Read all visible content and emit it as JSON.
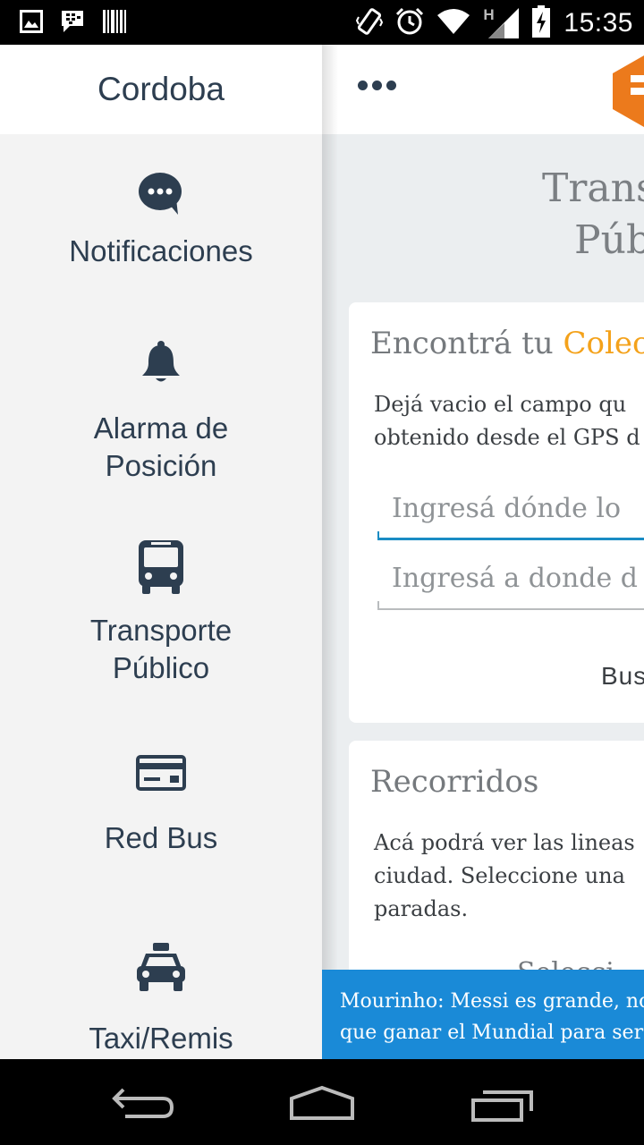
{
  "status_bar": {
    "time": "15:35",
    "network_label": "H",
    "left_icons": [
      "image-icon",
      "bbm-icon",
      "barcode-icon"
    ],
    "right_icons": [
      "vibrate-icon",
      "alarm-icon",
      "wifi-icon",
      "signal-icon",
      "battery-charging-icon"
    ]
  },
  "drawer": {
    "title": "Cordoba",
    "items": [
      {
        "icon": "chat-bubble-icon",
        "label": "Notificaciones"
      },
      {
        "icon": "bell-icon",
        "label_line1": "Alarma de",
        "label_line2": "Posición"
      },
      {
        "icon": "bus-icon",
        "label_line1": "Transporte",
        "label_line2": "Público"
      },
      {
        "icon": "card-icon",
        "label": "Red Bus"
      },
      {
        "icon": "taxi-icon",
        "label": "Taxi/Remis"
      }
    ]
  },
  "main": {
    "menu_icon": "more-dots-icon",
    "logo": "hexagon-logo",
    "title_line1": "Trans",
    "title_line2": "Púb",
    "search_card": {
      "title_prefix": "Encontrá tu ",
      "title_accent": "Colect",
      "desc_line1": "Dejá vacio el campo qu",
      "desc_line2": "obtenido desde el GPS d",
      "origin_placeholder": "Ingresá dónde lo",
      "destination_placeholder": "Ingresá a donde d",
      "button_label": "Bus"
    },
    "routes_card": {
      "title": "Recorridos",
      "desc_line1": "Acá podrá ver las lineas",
      "desc_line2": "ciudad. Seleccione una",
      "desc_line3": "paradas.",
      "select_label": "Selecci"
    },
    "ticker": {
      "line1": "Mourinho: Messi es grande, no",
      "line2": "que ganar el Mundial para ser d"
    }
  },
  "navbar": {
    "buttons": [
      "back-icon",
      "home-icon",
      "recents-icon"
    ]
  },
  "colors": {
    "accent": "#f4a21b",
    "primary_text": "#2d3e50",
    "ticker_bg": "#1a8ad7",
    "active_field": "#1a8cc4",
    "logo_orange": "#ec7a1c"
  }
}
